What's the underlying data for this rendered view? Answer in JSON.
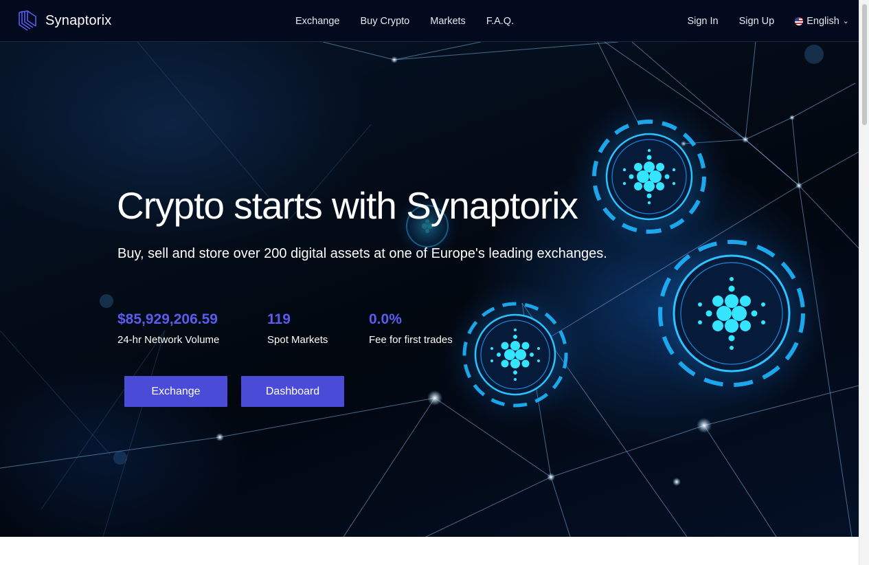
{
  "brand": {
    "name": "Synaptorix",
    "logo_icon": "layered-lines-logo-icon",
    "accent": "#4a4bd6"
  },
  "nav": {
    "items": [
      "Exchange",
      "Buy Crypto",
      "Markets",
      "F.A.Q."
    ]
  },
  "auth": {
    "sign_in": "Sign In",
    "sign_up": "Sign Up",
    "language": "English",
    "language_icon": "us-flag-icon"
  },
  "hero": {
    "title": "Crypto starts with Synaptorix",
    "subtitle": "Buy, sell and store over 200 digital assets at one of Europe's leading exchanges.",
    "stats": [
      {
        "value": "$85,929,206.59",
        "label": "24-hr Network Volume"
      },
      {
        "value": "119",
        "label": "Spot Markets"
      },
      {
        "value": "0.0%",
        "label": "Fee for first trades"
      }
    ],
    "buttons": {
      "exchange": "Exchange",
      "dashboard": "Dashboard"
    },
    "stat_color": "#5a5cf0",
    "background": "network-nodes-crypto-illustration"
  }
}
